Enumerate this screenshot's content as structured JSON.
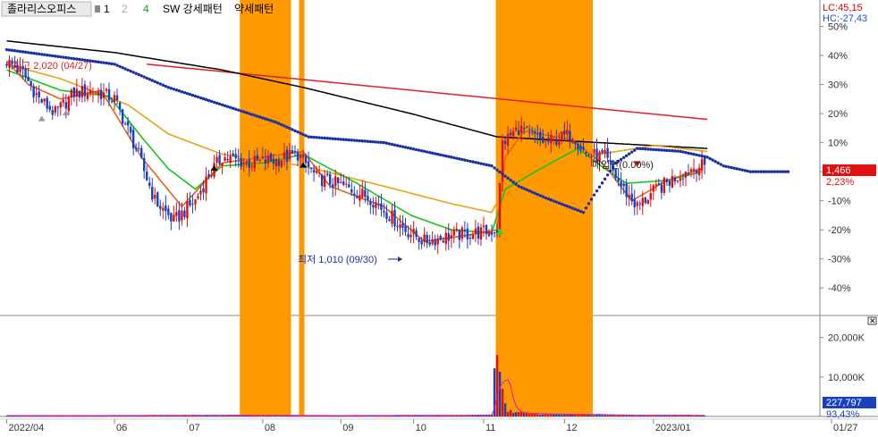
{
  "header": {
    "stock_name": "졸라리스오피스",
    "legend": [
      "1",
      "2",
      "4",
      "SW 강세패턴",
      "약세패턴"
    ],
    "lc": "LC:45,15",
    "hc": "HC:-27,43"
  },
  "price_panel": {
    "current_price": "1,466",
    "change_pct": "2,23%"
  },
  "volume_panel": {
    "current_volume": "227,797",
    "volume_pct": "93,43%"
  },
  "annotations": {
    "high": "최고 2,020 (04/27)",
    "low": "최저 1,010 (09/30)",
    "mid": "매입단(0.00%)"
  },
  "chart_data": {
    "type": "line",
    "title": "",
    "xlabel": "",
    "ylabel": "",
    "price_axis": {
      "ticks": [
        "50%",
        "40%",
        "30%",
        "20%",
        "10%",
        "0%",
        "-10%",
        "-20%",
        "-30%",
        "-40%"
      ],
      "values": [
        50,
        40,
        30,
        20,
        10,
        0,
        -10,
        -20,
        -30,
        -40
      ],
      "ylim": [
        -47,
        56
      ]
    },
    "volume_axis": {
      "ticks": [
        "20,000K",
        "10,000K"
      ],
      "values": [
        20000,
        10000
      ],
      "ylim": [
        0,
        24000
      ]
    },
    "x_ticks": [
      "2022/04",
      "06",
      "07",
      "08",
      "09",
      "10",
      "11",
      "12",
      "2023/01",
      "01/27"
    ],
    "x_tick_index": [
      0,
      40,
      67,
      95,
      124,
      151,
      177,
      207,
      240,
      312
    ],
    "bar_count": 260,
    "highlight_ranges": [
      [
        87,
        105
      ],
      [
        109,
        110
      ],
      [
        182,
        217
      ]
    ],
    "series": [
      {
        "name": "",
        "color": "#e02020",
        "anchors": [
          [
            52,
            37
          ],
          [
            260,
            18
          ]
        ]
      },
      {
        "name": "",
        "color": "#000000",
        "anchors": [
          [
            0,
            45
          ],
          [
            40,
            41
          ],
          [
            80,
            35
          ],
          [
            110,
            29
          ],
          [
            150,
            20
          ],
          [
            182,
            12
          ],
          [
            220,
            10
          ],
          [
            260,
            8
          ]
        ]
      },
      {
        "name": "",
        "color": "#e8a317",
        "anchors": [
          [
            0,
            37
          ],
          [
            20,
            32
          ],
          [
            45,
            23
          ],
          [
            60,
            13
          ],
          [
            80,
            6
          ],
          [
            110,
            2
          ],
          [
            140,
            -5
          ],
          [
            165,
            -11
          ],
          [
            180,
            -14
          ],
          [
            190,
            4
          ],
          [
            220,
            6
          ],
          [
            240,
            9
          ],
          [
            260,
            7
          ]
        ]
      },
      {
        "name": "",
        "color": "#18c418",
        "anchors": [
          [
            0,
            35
          ],
          [
            20,
            28
          ],
          [
            38,
            26
          ],
          [
            50,
            12
          ],
          [
            60,
            1
          ],
          [
            70,
            -6
          ],
          [
            80,
            2
          ],
          [
            95,
            3
          ],
          [
            110,
            6
          ],
          [
            130,
            -4
          ],
          [
            150,
            -15
          ],
          [
            165,
            -20
          ],
          [
            180,
            -21
          ],
          [
            185,
            -6
          ],
          [
            200,
            2
          ],
          [
            212,
            8
          ],
          [
            222,
            1
          ],
          [
            230,
            -4
          ],
          [
            245,
            -3
          ],
          [
            258,
            0
          ]
        ]
      },
      {
        "name": "",
        "color": "#e8601a",
        "anchors": [
          [
            0,
            38
          ],
          [
            8,
            30
          ],
          [
            20,
            25
          ],
          [
            35,
            28
          ],
          [
            50,
            5
          ],
          [
            65,
            -12
          ],
          [
            80,
            3
          ],
          [
            95,
            5
          ],
          [
            110,
            7
          ],
          [
            120,
            -5
          ],
          [
            140,
            -12
          ],
          [
            155,
            -24
          ],
          [
            170,
            -22
          ],
          [
            182,
            -20
          ],
          [
            185,
            5
          ],
          [
            192,
            14
          ],
          [
            210,
            11
          ],
          [
            222,
            2
          ],
          [
            232,
            -10
          ],
          [
            245,
            -3
          ],
          [
            258,
            1
          ]
        ]
      }
    ],
    "dots_color": "#1a2fa8",
    "dots": [
      [
        0,
        42
      ],
      [
        40,
        37
      ],
      [
        60,
        29
      ],
      [
        80,
        23
      ],
      [
        100,
        17
      ],
      [
        112,
        12
      ],
      [
        140,
        10
      ],
      [
        160,
        6
      ],
      [
        180,
        2
      ],
      [
        190,
        -5
      ],
      [
        200,
        -9
      ],
      [
        214,
        -14
      ],
      [
        218,
        -8
      ],
      [
        226,
        3
      ],
      [
        234,
        8
      ],
      [
        250,
        7
      ],
      [
        260,
        5
      ],
      [
        266,
        2
      ],
      [
        276,
        0
      ],
      [
        290,
        0
      ]
    ],
    "price_anchors": [
      [
        0,
        38
      ],
      [
        6,
        34
      ],
      [
        12,
        25
      ],
      [
        18,
        20
      ],
      [
        25,
        27
      ],
      [
        32,
        28
      ],
      [
        40,
        25
      ],
      [
        48,
        8
      ],
      [
        55,
        -10
      ],
      [
        62,
        -17
      ],
      [
        70,
        -10
      ],
      [
        75,
        -1
      ],
      [
        80,
        5
      ],
      [
        90,
        3
      ],
      [
        100,
        4
      ],
      [
        108,
        6
      ],
      [
        115,
        -2
      ],
      [
        125,
        -5
      ],
      [
        135,
        -9
      ],
      [
        148,
        -20
      ],
      [
        155,
        -24
      ],
      [
        165,
        -22
      ],
      [
        175,
        -21
      ],
      [
        182,
        -20
      ],
      [
        184,
        10
      ],
      [
        190,
        15
      ],
      [
        200,
        10
      ],
      [
        210,
        13
      ],
      [
        215,
        6
      ],
      [
        222,
        5
      ],
      [
        228,
        -5
      ],
      [
        234,
        -12
      ],
      [
        240,
        -7
      ],
      [
        248,
        -2
      ],
      [
        256,
        2
      ],
      [
        260,
        2
      ]
    ],
    "volume_anchors": [
      [
        0,
        220
      ],
      [
        40,
        240
      ],
      [
        80,
        320
      ],
      [
        120,
        230
      ],
      [
        170,
        300
      ],
      [
        180,
        400
      ],
      [
        182,
        20000
      ],
      [
        184,
        6500
      ],
      [
        186,
        1700
      ],
      [
        190,
        900
      ],
      [
        200,
        600
      ],
      [
        217,
        500
      ],
      [
        230,
        320
      ],
      [
        260,
        300
      ]
    ],
    "up_color": "#e01010",
    "down_color": "#1a3fbf",
    "highlight_color": "#ff9900"
  }
}
